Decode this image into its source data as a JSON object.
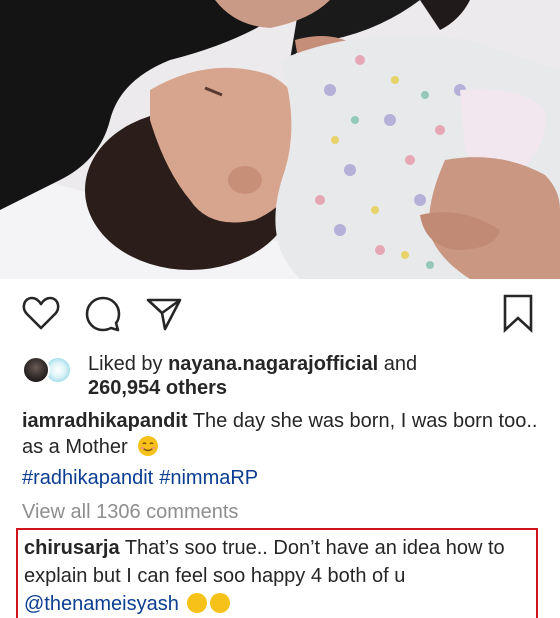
{
  "post": {
    "liked_by_prefix": "Liked by",
    "liked_by_user": "nayana.nagarajofficial",
    "liked_by_and": "and",
    "others_count": "260,954 others",
    "caption_user": "iamradhikapandit",
    "caption_text": "The day she was born, I was born too.. as a Mother",
    "hashtags": [
      "#radhikapandit",
      "#nimmaRP"
    ],
    "view_all_comments": "View all 1306 comments"
  },
  "comment": {
    "user": "chirusarja",
    "text": "That’s soo true.. Don’t have an idea how to explain but I can feel soo happy 4 both of u",
    "mention": "@thenameisyash"
  },
  "icons": {
    "like": "heart-icon",
    "comment": "comment-bubble-icon",
    "share": "paper-plane-icon",
    "save": "bookmark-icon",
    "emoji": "smiling-face-emoji"
  },
  "colors": {
    "hashtag": "#0b3d91",
    "muted": "#8e8e8e",
    "highlight_border": "#d0141c"
  }
}
